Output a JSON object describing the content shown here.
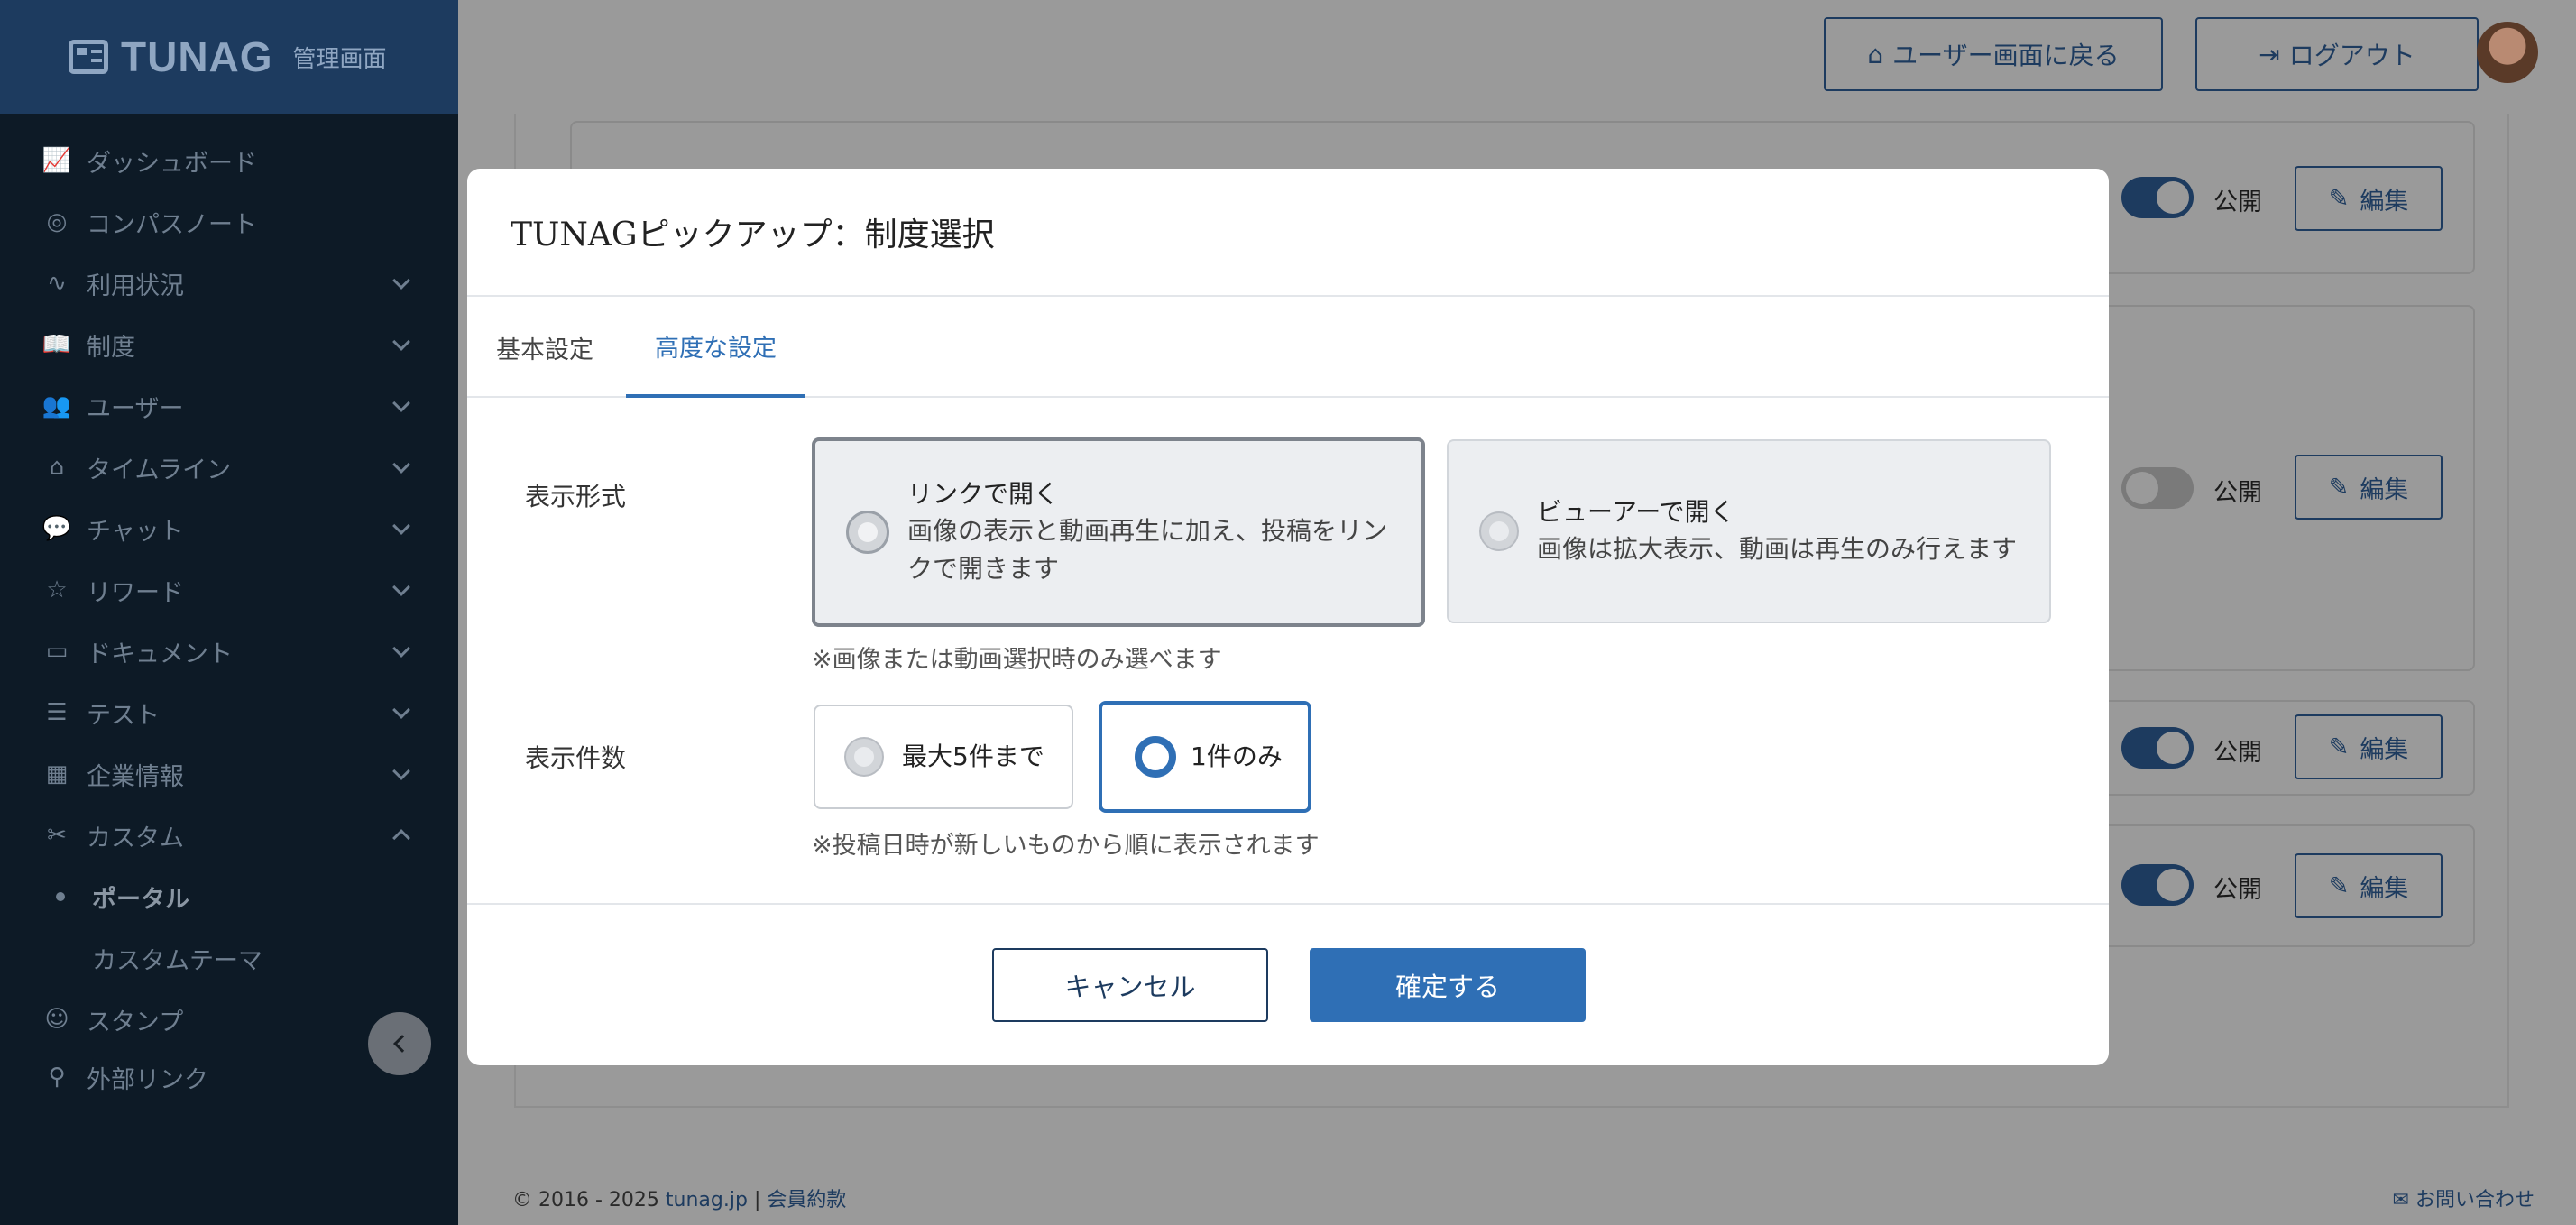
{
  "brand": {
    "name": "TUNAG",
    "sub": "管理画面"
  },
  "sidebar": {
    "items": [
      {
        "label": "ダッシュボード",
        "icon": "chart-icon"
      },
      {
        "label": "コンパスノート",
        "icon": "compass-icon"
      },
      {
        "label": "利用状況",
        "icon": "activity-icon"
      },
      {
        "label": "制度",
        "icon": "book-icon"
      },
      {
        "label": "ユーザー",
        "icon": "users-icon"
      },
      {
        "label": "タイムライン",
        "icon": "home-icon"
      },
      {
        "label": "チャット",
        "icon": "chat-icon"
      },
      {
        "label": "リワード",
        "icon": "star-icon"
      },
      {
        "label": "ドキュメント",
        "icon": "folder-icon"
      },
      {
        "label": "テスト",
        "icon": "list-icon"
      },
      {
        "label": "企業情報",
        "icon": "building-icon"
      },
      {
        "label": "カスタム",
        "icon": "tools-icon"
      }
    ],
    "sub_items": [
      {
        "label": "ポータル"
      },
      {
        "label": "カスタムテーマ"
      }
    ],
    "after": [
      {
        "label": "スタンプ",
        "icon": "smile-icon"
      },
      {
        "label": "外部リンク",
        "icon": "link-icon"
      }
    ]
  },
  "topbar": {
    "back_label": "ユーザー画面に戻る",
    "logout_label": "ログアウト"
  },
  "background_rows": {
    "public_label": "公開",
    "edit_label": "編集"
  },
  "footer": {
    "copyright": "© 2016 - 2025",
    "site": "tunag.jp",
    "separator": "|",
    "terms": "会員約款",
    "contact": "お問い合わせ"
  },
  "modal": {
    "title": "TUNAGピックアップ：制度選択",
    "tabs": [
      {
        "label": "基本設定"
      },
      {
        "label": "高度な設定"
      }
    ],
    "display_format": {
      "label": "表示形式",
      "options": [
        {
          "title": "リンクで開く",
          "desc_line1": "画像の表示と動画再生に加え、投稿をリン",
          "desc_line2": "クで開きます"
        },
        {
          "title": "ビューアーで開く",
          "desc": "画像は拡大表示、動画は再生のみ行えます"
        }
      ],
      "hint": "※画像または動画選択時のみ選べます"
    },
    "display_count": {
      "label": "表示件数",
      "options": [
        {
          "title": "最大5件まで"
        },
        {
          "title": "1件のみ"
        }
      ],
      "hint": "※投稿日時が新しいものから順に表示されます"
    },
    "cancel_label": "キャンセル",
    "confirm_label": "確定する"
  },
  "colors": {
    "accent": "#2f6fb5",
    "sidebar_bg": "#0d1a26",
    "overlay": "#9a9a9a"
  }
}
